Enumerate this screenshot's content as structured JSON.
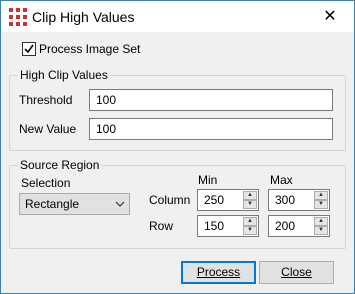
{
  "window": {
    "title": "Clip High Values"
  },
  "process_image_set": {
    "label": "Process Image Set",
    "checked": true
  },
  "high_clip": {
    "legend": "High Clip Values",
    "threshold_label": "Threshold",
    "threshold_value": "100",
    "new_value_label": "New Value",
    "new_value_value": "100"
  },
  "source_region": {
    "legend": "Source Region",
    "selection_label": "Selection",
    "selection_value": "Rectangle",
    "min_header": "Min",
    "max_header": "Max",
    "column_label": "Column",
    "row_label": "Row",
    "column_min": "250",
    "column_max": "300",
    "row_min": "150",
    "row_max": "200"
  },
  "buttons": {
    "process": "Process",
    "close": "Close"
  }
}
